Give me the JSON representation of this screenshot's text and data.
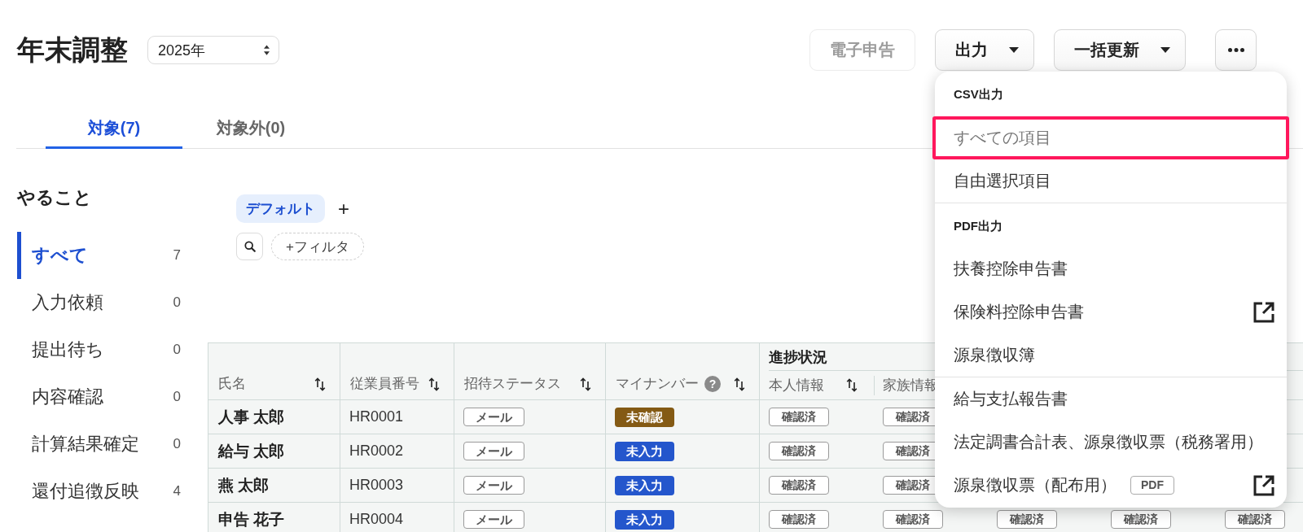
{
  "header": {
    "title": "年末調整",
    "year_select": {
      "value": "2025年"
    },
    "buttons": [
      {
        "kind": "text",
        "label": "電子申告",
        "disabled": true
      },
      {
        "kind": "menu",
        "label": "出力",
        "disabled": false
      },
      {
        "kind": "menu",
        "label": "一括更新",
        "disabled": false
      },
      {
        "kind": "more",
        "disabled": false
      }
    ]
  },
  "tabs": [
    {
      "label": "対象(7)",
      "selected": true
    },
    {
      "label": "対象外(0)",
      "selected": false
    }
  ],
  "sidebar": {
    "title": "やること",
    "items": [
      {
        "label": "すべて",
        "count": "7",
        "selected": true
      },
      {
        "label": "入力依頼",
        "count": "0",
        "selected": false
      },
      {
        "label": "提出待ち",
        "count": "0",
        "selected": false
      },
      {
        "label": "内容確認",
        "count": "0",
        "selected": false
      },
      {
        "label": "計算結果確定",
        "count": "0",
        "selected": false
      },
      {
        "label": "還付追徴反映",
        "count": "4",
        "selected": false
      }
    ]
  },
  "views": {
    "items": [
      {
        "label": "デフォルト",
        "selected": true
      }
    ],
    "add_label": "+",
    "filter_label": "+フィルタ"
  },
  "table": {
    "columns": [
      {
        "label": "氏名",
        "sortable": true
      },
      {
        "label": "従業員番号",
        "sortable": true
      },
      {
        "label": "招待ステータス",
        "sortable": true
      },
      {
        "label": "マイナンバー",
        "sortable": true,
        "help": "?"
      }
    ],
    "group": {
      "label": "進捗状況",
      "columns": [
        {
          "label": "本人情報",
          "sortable": true
        },
        {
          "label": "家族情報"
        }
      ]
    },
    "rows": [
      {
        "name": "人事 太郎",
        "employee_id": "HR0001",
        "invitation": "メール",
        "my_number": {
          "label": "未確認",
          "color": "#845a14"
        },
        "progress": [
          "確認済",
          "確認済"
        ]
      },
      {
        "name": "給与 太郎",
        "employee_id": "HR0002",
        "invitation": "メール",
        "my_number": {
          "label": "未入力",
          "color": "#2456cc"
        },
        "progress": [
          "確認済",
          "確認済"
        ]
      },
      {
        "name": "燕 太郎",
        "employee_id": "HR0003",
        "invitation": "メール",
        "my_number": {
          "label": "未入力",
          "color": "#2456cc"
        },
        "progress": [
          "確認済",
          "確認済"
        ]
      },
      {
        "name": "申告 花子",
        "employee_id": "HR0004",
        "invitation": "メール",
        "my_number": {
          "label": "未入力",
          "color": "#2456cc"
        },
        "progress": [
          "確認済",
          "確認済",
          "確認済",
          "確認済",
          "確認済"
        ]
      }
    ]
  },
  "menu": {
    "sections": [
      {
        "title": "CSV出力",
        "items": [
          {
            "label": "すべての項目",
            "highlighted": true,
            "external": false
          },
          {
            "label": "自由選択項目",
            "highlighted": false,
            "external": false
          }
        ]
      },
      {
        "title": "PDF出力",
        "items": [
          {
            "label": "扶養控除申告書",
            "highlighted": false,
            "external": false
          },
          {
            "label": "保険料控除申告書",
            "highlighted": false,
            "external": true
          },
          {
            "label": "源泉徴収簿",
            "highlighted": false,
            "external": false
          }
        ]
      },
      {
        "items": [
          {
            "label": "給与支払報告書",
            "highlighted": false,
            "external": false
          },
          {
            "label": "法定調書合計表、源泉徴収票（税務署用）",
            "highlighted": false,
            "external": false
          },
          {
            "label": "源泉徴収票（配布用）",
            "badge": "PDF",
            "highlighted": false,
            "external": true
          }
        ]
      }
    ]
  }
}
